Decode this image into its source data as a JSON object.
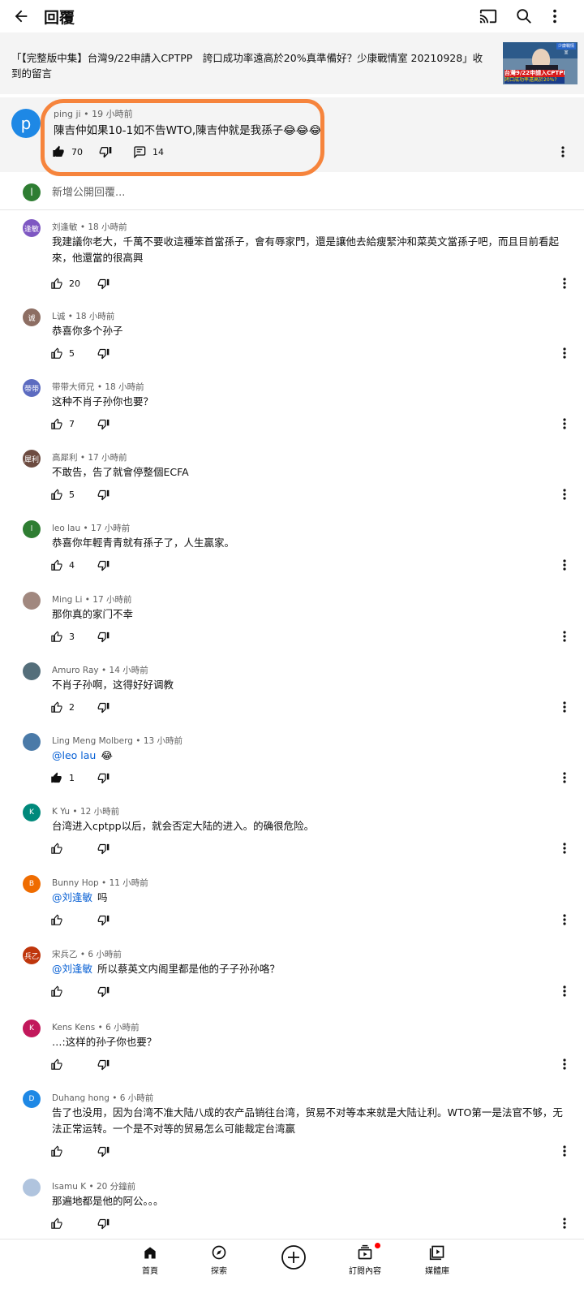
{
  "header": {
    "title": "回覆",
    "icons": [
      "back-arrow-icon",
      "cast-icon",
      "search-icon",
      "more-vert-icon"
    ]
  },
  "video": {
    "title": "「【完整版中集】台灣9/22申請入CPTPP　誇口成功率遠高於20%真準備好？少康戰情室 20210928」收到的留言",
    "thumb_line1": "台灣9/22申請入CPTPP",
    "thumb_line2": "誇口成功率遠高於20%?",
    "thumb_badge": "少康戰情室"
  },
  "main_comment": {
    "avatar_letter": "p",
    "author": "ping ji",
    "time": "19 小時前",
    "text": "陳吉仲如果10-1如不告WTO,陳吉仲就是我孫子😂😂😂",
    "likes": "70",
    "replies": "14",
    "liked": true
  },
  "add_reply": {
    "avatar_letter": "l",
    "placeholder": "新增公開回覆..."
  },
  "replies": [
    {
      "author": "刘逢敏",
      "time": "18 小時前",
      "avatar_text": "逢敏",
      "avatar_color": "#7e57c2",
      "mention": "",
      "text": "我建議你老大，千萬不要收這種笨首當孫子，會有辱家門，還是讓他去給瘦緊沖和菜英文當孫子吧，而且目前看起來，他還當的很高興",
      "likes": "20",
      "liked": false
    },
    {
      "author": "L诚",
      "time": "18 小時前",
      "avatar_text": "诚",
      "avatar_color": "#8d6e63",
      "mention": "",
      "text": "恭喜你多个孙子",
      "likes": "5",
      "liked": false
    },
    {
      "author": "带带大师兄",
      "time": "18 小時前",
      "avatar_text": "带带",
      "avatar_color": "#5c6bc0",
      "mention": "",
      "text": "这种不肖子孙你也要？",
      "likes": "7",
      "liked": false
    },
    {
      "author": "高犀利",
      "time": "17 小時前",
      "avatar_text": "犀利",
      "avatar_color": "#6d4c41",
      "mention": "",
      "text": "不敢告，告了就會停整個ECFA",
      "likes": "5",
      "liked": false
    },
    {
      "author": "leo lau",
      "time": "17 小時前",
      "avatar_text": "l",
      "avatar_color": "#2e7d32",
      "mention": "",
      "text": "恭喜你年輕青青就有孫子了，人生贏家。",
      "likes": "4",
      "liked": false
    },
    {
      "author": "Ming Li",
      "time": "17 小時前",
      "avatar_text": "",
      "avatar_color": "#a1887f",
      "mention": "",
      "text": "那你真的家门不幸",
      "likes": "3",
      "liked": false
    },
    {
      "author": "Amuro Ray",
      "time": "14 小時前",
      "avatar_text": "",
      "avatar_color": "#546e7a",
      "mention": "",
      "text": "不肖子孙啊，这得好好调教",
      "likes": "2",
      "liked": false
    },
    {
      "author": "Ling Meng Molberg",
      "time": "13 小時前",
      "avatar_text": "",
      "avatar_color": "#4a7aa8",
      "mention": "@leo lau",
      "text": "😂",
      "likes": "1",
      "liked": true
    },
    {
      "author": "K Yu",
      "time": "12 小時前",
      "avatar_text": "K",
      "avatar_color": "#00897b",
      "mention": "",
      "text": "台湾进入cptpp以后，就会否定大陆的进入。的确很危险。",
      "likes": "",
      "liked": false
    },
    {
      "author": "Bunny Hop",
      "time": "11 小時前",
      "avatar_text": "B",
      "avatar_color": "#ef6c00",
      "mention": "@刘逢敏",
      "text": "吗",
      "likes": "",
      "liked": false
    },
    {
      "author": "宋兵乙",
      "time": "6 小時前",
      "avatar_text": "兵乙",
      "avatar_color": "#bf360c",
      "mention": "@刘逢敏",
      "text": "所以蔡英文内阁里都是他的子子孙孙咯？",
      "likes": "",
      "liked": false
    },
    {
      "author": "Kens Kens",
      "time": "6 小時前",
      "avatar_text": "K",
      "avatar_color": "#c2185b",
      "mention": "",
      "text": "…:这样的孙子你也要？",
      "likes": "",
      "liked": false
    },
    {
      "author": "Duhang hong",
      "time": "6 小時前",
      "avatar_text": "D",
      "avatar_color": "#1e88e5",
      "mention": "",
      "text": "告了也没用，因为台湾不准大陆八成的农产品销往台湾，贸易不对等本来就是大陆让利。WTO第一是法官不够，无法正常运转。一个是不对等的贸易怎么可能裁定台湾赢",
      "likes": "",
      "liked": false
    },
    {
      "author": "Isamu K",
      "time": "20 分鐘前",
      "avatar_text": "",
      "avatar_color": "#b0c4de",
      "mention": "",
      "text": "那遍地都是他的阿公。。。",
      "likes": "",
      "liked": false
    }
  ],
  "bottom_nav": {
    "home": "首頁",
    "explore": "探索",
    "subscriptions": "訂閱內容",
    "library": "媒體庫"
  }
}
